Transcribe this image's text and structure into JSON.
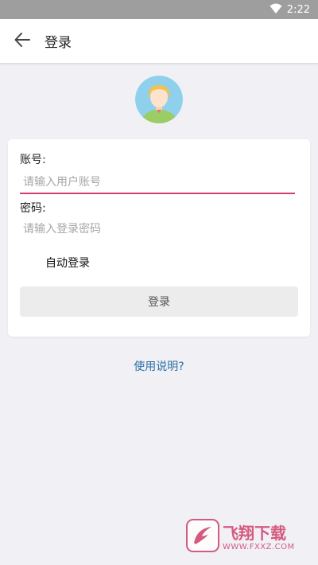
{
  "status_bar": {
    "time": "2:22",
    "icons": [
      "wifi-icon"
    ]
  },
  "app_bar": {
    "title": "登录",
    "back_icon": "arrow-left-icon"
  },
  "avatar": {
    "icon": "user-avatar-icon"
  },
  "form": {
    "account_label": "账号:",
    "account_placeholder": "请输入用户账号",
    "account_value": "",
    "password_label": "密码:",
    "password_placeholder": "请输入登录密码",
    "password_value": "",
    "auto_login_label": "自动登录",
    "login_button_label": "登录"
  },
  "help_link": "使用说明?",
  "watermark": {
    "main": "飞翔下载",
    "sub": "WWW.FXXZ.COM"
  },
  "colors": {
    "accent": "#d0406a",
    "link": "#2b6fa6",
    "background": "#f0f0f5"
  }
}
